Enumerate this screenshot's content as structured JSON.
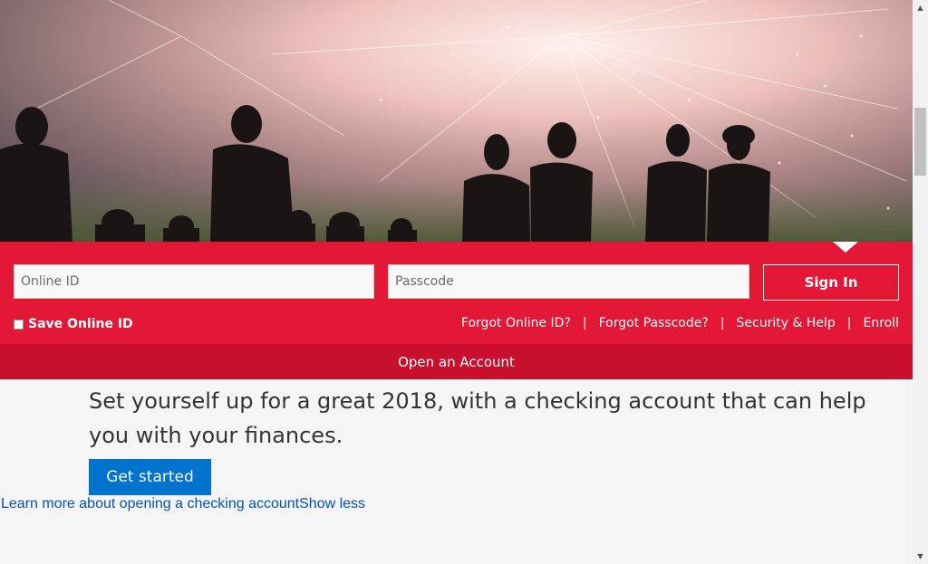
{
  "login": {
    "online_id_placeholder": "Online ID",
    "passcode_placeholder": "Passcode",
    "sign_in_label": "Sign In",
    "save_online_id_label": "Save Online ID",
    "links": {
      "forgot_online_id": "Forgot Online ID?",
      "forgot_passcode": "Forgot Passcode?",
      "security_help": "Security & Help",
      "enroll": "Enroll",
      "separator": "|"
    }
  },
  "open_account_label": "Open an Account",
  "promo": {
    "headline": "Set yourself up for a great 2018, with a checking account that can help you with your finances.",
    "cta_label": "Get started",
    "learn_more": "Learn more about opening a checking account",
    "show_less": "Show less"
  },
  "colors": {
    "brand_red": "#e31837",
    "dark_red": "#c8102e",
    "cta_blue": "#0073cf",
    "link_blue": "#0052c2"
  },
  "icons": {
    "scroll_up": "▲",
    "scroll_down": "▼"
  }
}
